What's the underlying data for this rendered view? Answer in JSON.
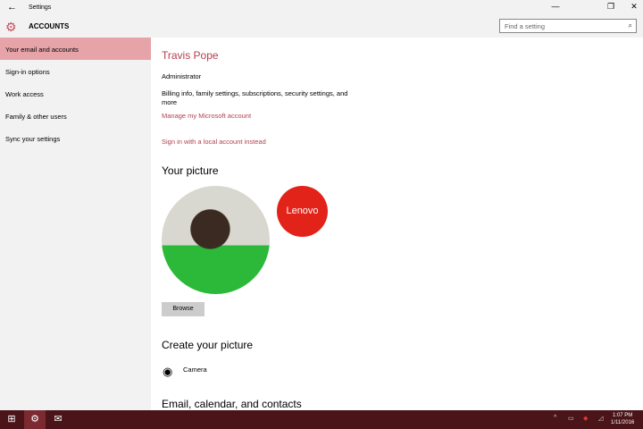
{
  "window": {
    "title": "Settings",
    "section": "ACCOUNTS",
    "search_placeholder": "Find a setting"
  },
  "sidebar": {
    "items": [
      {
        "label": "Your email and accounts"
      },
      {
        "label": "Sign-in options"
      },
      {
        "label": "Work access"
      },
      {
        "label": "Family & other users"
      },
      {
        "label": "Sync your settings"
      }
    ]
  },
  "account": {
    "name": "Travis Pope",
    "role": "Administrator",
    "billing": "Billing info, family settings, subscriptions, security settings, and",
    "billing2": "more",
    "manage_link": "Manage my Microsoft account",
    "local_link": "Sign in with a local account instead"
  },
  "picture": {
    "heading": "Your picture",
    "lenovo": "Lenovo",
    "browse": "Browse"
  },
  "create": {
    "heading": "Create your picture",
    "camera": "Camera"
  },
  "email": {
    "heading": "Email, calendar, and contacts"
  },
  "taskbar": {
    "time": "1:07 PM",
    "date": "1/11/2016"
  }
}
